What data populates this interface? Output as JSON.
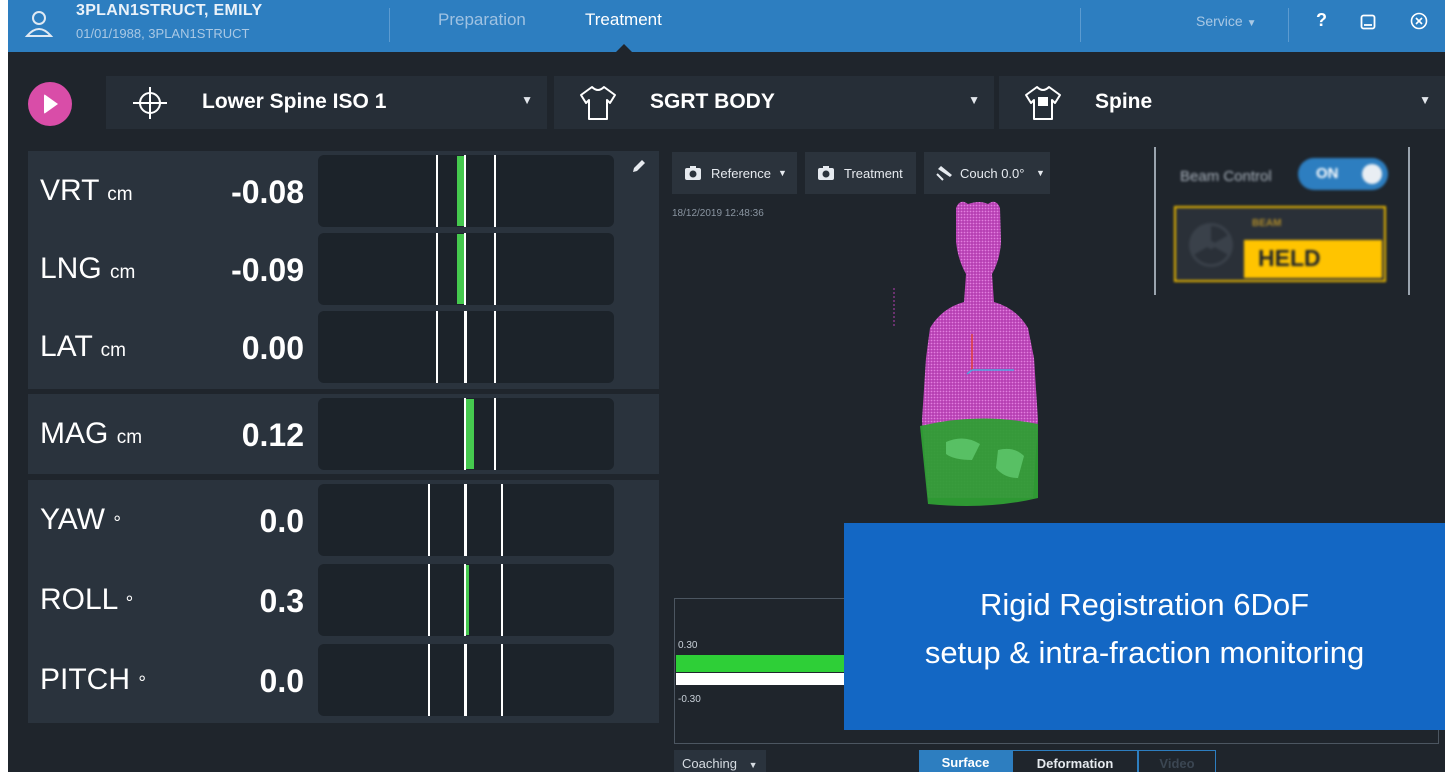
{
  "header": {
    "patient_name": "3PLAN1STRUCT, EMILY",
    "patient_sub": "01/01/1988, 3PLAN1STRUCT",
    "tabs": [
      {
        "label": "Preparation",
        "active": false
      },
      {
        "label": "Treatment",
        "active": true
      }
    ],
    "service_label": "Service",
    "help_label": "?"
  },
  "selectors": {
    "isocenter": "Lower Spine ISO 1",
    "body": "SGRT BODY",
    "region": "Spine"
  },
  "metrics": [
    {
      "label": "VRT",
      "unit": "cm",
      "value": "-0.08",
      "fill": "green",
      "position": -0.08
    },
    {
      "label": "LNG",
      "unit": "cm",
      "value": "-0.09",
      "fill": "green",
      "position": -0.09
    },
    {
      "label": "LAT",
      "unit": "cm",
      "value": "0.00",
      "fill": "none",
      "position": 0.0
    },
    {
      "label": "MAG",
      "unit": "cm",
      "value": "0.12",
      "fill": "green",
      "position": 0.12
    },
    {
      "label": "YAW",
      "unit": "°",
      "value": "0.0",
      "fill": "none",
      "position": 0.0
    },
    {
      "label": "ROLL",
      "unit": "°",
      "value": "0.3",
      "fill": "green",
      "position": 0.3
    },
    {
      "label": "PITCH",
      "unit": "°",
      "value": "0.0",
      "fill": "none",
      "position": 0.0
    }
  ],
  "viewer": {
    "reference_label": "Reference",
    "treatment_label": "Treatment",
    "couch_label": "Couch 0.0°",
    "timestamp": "18/12/2019 12:48:36"
  },
  "beam": {
    "label": "Beam Control",
    "toggle": "ON",
    "status_title": "BEAM",
    "status": "HELD"
  },
  "trace": {
    "upper": "0.30",
    "lower": "-0.30"
  },
  "bottom": {
    "coaching": "Coaching",
    "tabs": [
      "Surface",
      "Deformation",
      "Video"
    ]
  },
  "caption": {
    "line1": "Rigid Registration 6DoF",
    "line2": "setup & intra-fraction monitoring"
  },
  "colors": {
    "accent": "#2d7ec0",
    "play": "#d94da8",
    "ok_green": "#45c94e",
    "held_yellow": "#ffc400",
    "caption_blue": "#1367c4"
  }
}
